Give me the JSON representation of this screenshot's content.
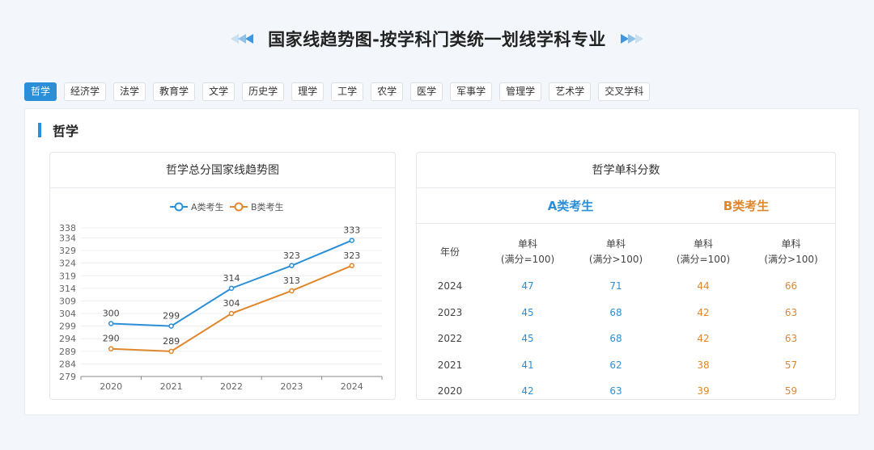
{
  "page": {
    "title": "国家线趋势图-按学科门类统一划线学科专业"
  },
  "tabs": [
    {
      "label": "哲学",
      "active": true
    },
    {
      "label": "经济学",
      "active": false
    },
    {
      "label": "法学",
      "active": false
    },
    {
      "label": "教育学",
      "active": false
    },
    {
      "label": "文学",
      "active": false
    },
    {
      "label": "历史学",
      "active": false
    },
    {
      "label": "理学",
      "active": false
    },
    {
      "label": "工学",
      "active": false
    },
    {
      "label": "农学",
      "active": false
    },
    {
      "label": "医学",
      "active": false
    },
    {
      "label": "军事学",
      "active": false
    },
    {
      "label": "管理学",
      "active": false
    },
    {
      "label": "艺术学",
      "active": false
    },
    {
      "label": "交叉学科",
      "active": false
    }
  ],
  "section": {
    "title": "哲学"
  },
  "chart_card": {
    "title": "哲学总分国家线趋势图"
  },
  "table_card": {
    "title": "哲学单科分数",
    "group_a": "A类考生",
    "group_b": "B类考生",
    "headers": [
      {
        "line1": "年份",
        "line2": ""
      },
      {
        "line1": "单科",
        "line2": "(满分=100)"
      },
      {
        "line1": "单科",
        "line2": "(满分>100)"
      },
      {
        "line1": "单科",
        "line2": "(满分=100)"
      },
      {
        "line1": "单科",
        "line2": "(满分>100)"
      }
    ],
    "rows": [
      {
        "year": "2024",
        "a1": "47",
        "a2": "71",
        "b1": "44",
        "b2": "66"
      },
      {
        "year": "2023",
        "a1": "45",
        "a2": "68",
        "b1": "42",
        "b2": "63"
      },
      {
        "year": "2022",
        "a1": "45",
        "a2": "68",
        "b1": "42",
        "b2": "63"
      },
      {
        "year": "2021",
        "a1": "41",
        "a2": "62",
        "b1": "38",
        "b2": "57"
      },
      {
        "year": "2020",
        "a1": "42",
        "a2": "63",
        "b1": "39",
        "b2": "59"
      }
    ]
  },
  "colors": {
    "accent": "#2b8fd8",
    "series_a": "#2b8fd8",
    "series_b": "#e0872b"
  },
  "chart_data": {
    "type": "line",
    "x": [
      "2020",
      "2021",
      "2022",
      "2023",
      "2024"
    ],
    "series": [
      {
        "name": "A类考生",
        "values": [
          300,
          299,
          314,
          323,
          333
        ],
        "color": "#2b8fd8"
      },
      {
        "name": "B类考生",
        "values": [
          290,
          289,
          304,
          313,
          323
        ],
        "color": "#e0872b"
      }
    ],
    "yticks": [
      279,
      284,
      289,
      294,
      299,
      304,
      309,
      314,
      319,
      324,
      329,
      334,
      338
    ],
    "ylim": [
      279,
      338
    ],
    "legend": "top-center",
    "grid": true
  }
}
